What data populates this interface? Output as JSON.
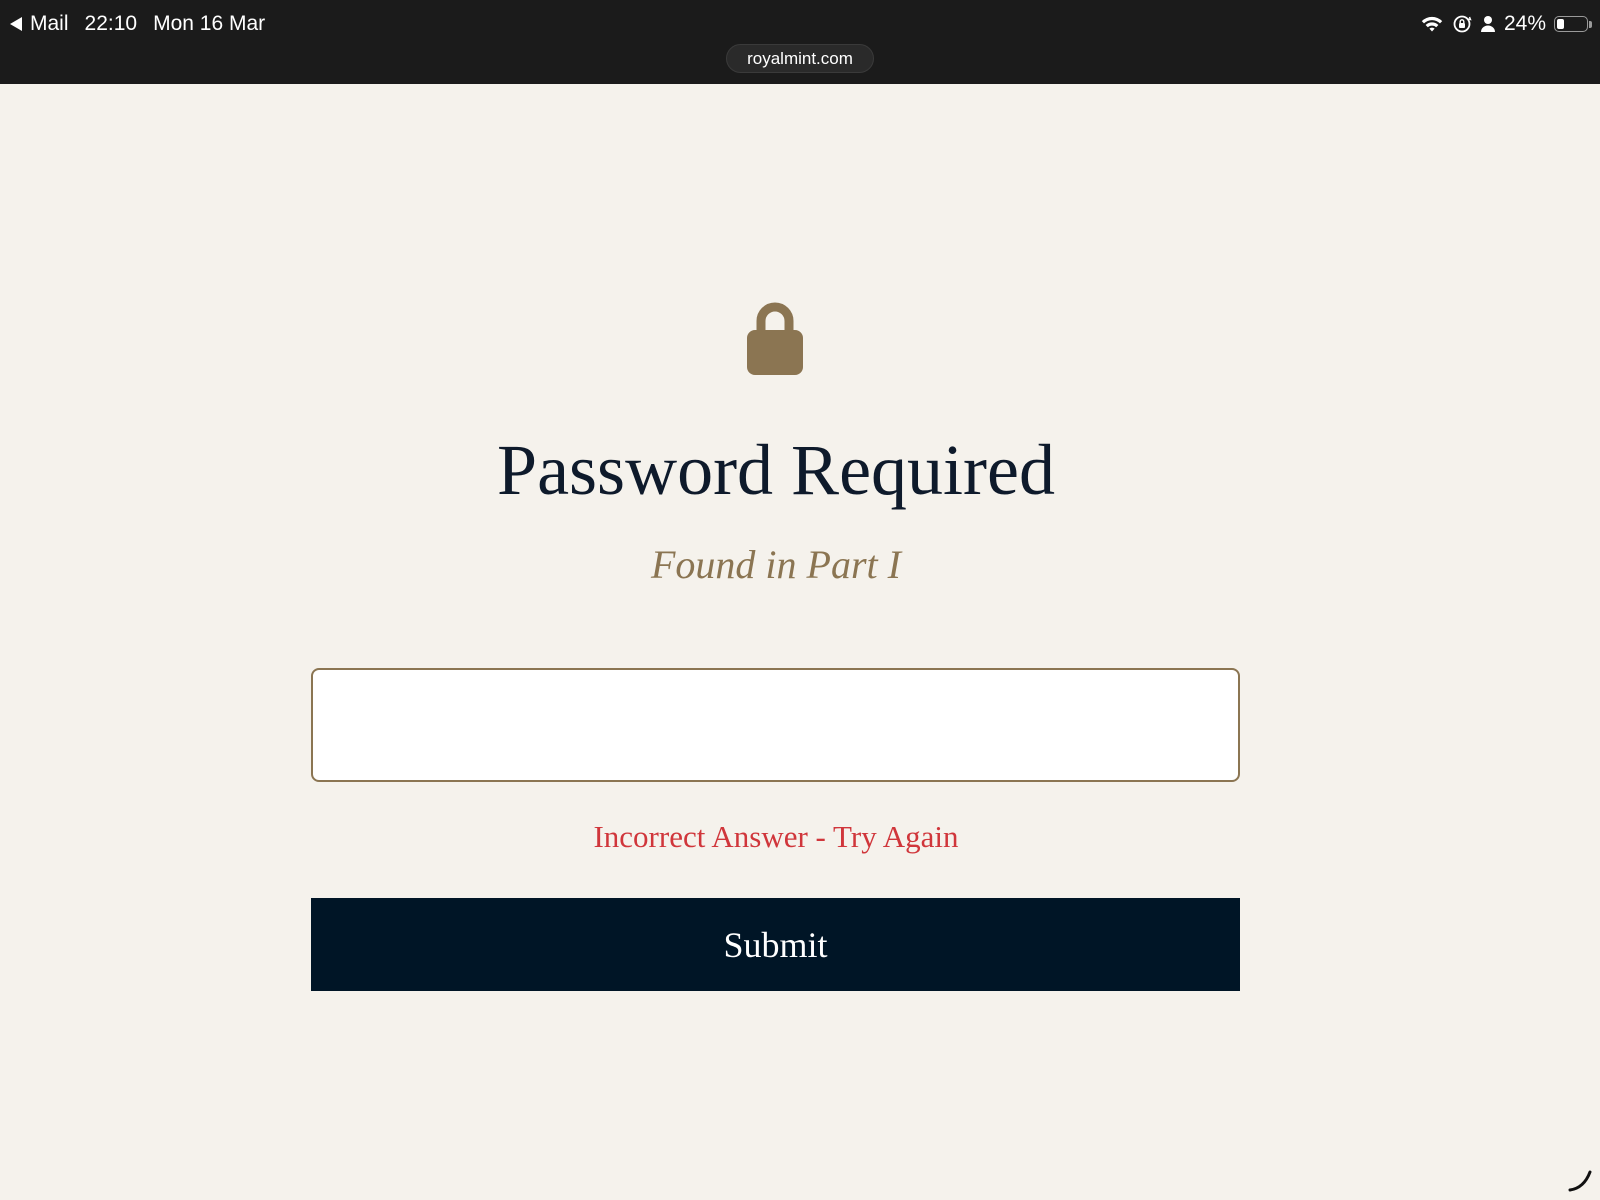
{
  "status_bar": {
    "back_label": "Mail",
    "time": "22:10",
    "date": "Mon 16 Mar",
    "battery_percent_label": "24%",
    "battery_level": 0.24,
    "icons": [
      "wifi-icon",
      "orientation-lock-icon",
      "person-icon",
      "battery-icon"
    ]
  },
  "browser": {
    "url": "royalmint.com"
  },
  "page": {
    "lock_icon": "lock-icon",
    "title": "Password Required",
    "subtitle": "Found in Part I",
    "password_input": {
      "value": "",
      "placeholder": ""
    },
    "error_message": "Incorrect Answer - Try Again",
    "submit_label": "Submit"
  },
  "colors": {
    "background": "#f5f2ec",
    "status_bar": "#1b1b1b",
    "accent_gold": "#8b7552",
    "title_navy": "#0e1a2b",
    "button_navy": "#001526",
    "error_red": "#d0363b"
  }
}
